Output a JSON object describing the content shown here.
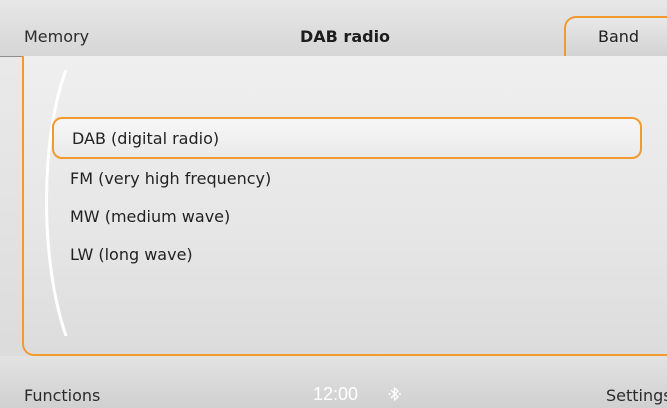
{
  "header": {
    "left_label": "Memory",
    "title": "DAB radio",
    "tab_label": "Band"
  },
  "band_menu": {
    "items": [
      {
        "label": "DAB (digital radio)",
        "selected": true
      },
      {
        "label": "FM (very high frequency)",
        "selected": false
      },
      {
        "label": "MW (medium wave)",
        "selected": false
      },
      {
        "label": "LW (long wave)",
        "selected": false
      }
    ]
  },
  "footer": {
    "left_label": "Functions",
    "time": "12:00",
    "right_label": "Settings"
  },
  "colors": {
    "accent": "#f39a2f",
    "background": "#e6e6e6",
    "time_text": "#ffffff"
  },
  "icons": {
    "status": "bluetooth-icon"
  }
}
